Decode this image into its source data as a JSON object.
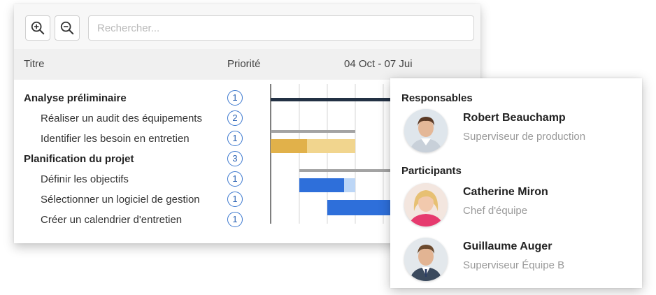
{
  "toolbar": {
    "zoom_in_icon": "zoom-in-icon",
    "zoom_out_icon": "zoom-out-icon",
    "search_placeholder": "Rechercher..."
  },
  "columns": {
    "title": "Titre",
    "priority": "Priorité",
    "timeline": "04 Oct - 07 Jui"
  },
  "tasks": [
    {
      "title": "Analyse préliminaire",
      "priority": "1",
      "group": true
    },
    {
      "title": "Réaliser un audit des équipements",
      "priority": "2",
      "group": false
    },
    {
      "title": "Identifier les besoin en entretien",
      "priority": "1",
      "group": false
    },
    {
      "title": "Planification du projet",
      "priority": "3",
      "group": true
    },
    {
      "title": "Définir les objectifs",
      "priority": "1",
      "group": false
    },
    {
      "title": "Sélectionner un logiciel de gestion",
      "priority": "1",
      "group": false
    },
    {
      "title": "Créer un calendrier d'entretien",
      "priority": "1",
      "group": false
    }
  ],
  "colors": {
    "summary_dark": "#233144",
    "summary_grey": "#a3a3a3",
    "bar_gold": "#e1b14a",
    "bar_gold_light": "#f1d58e",
    "bar_blue": "#2e6fda",
    "bar_blue_light": "#bcd6f6",
    "priority_blue": "#3d79cf"
  },
  "popover": {
    "responsables_heading": "Responsables",
    "participants_heading": "Participants",
    "responsables": [
      {
        "name": "Robert Beauchamp",
        "role": "Superviseur de production"
      }
    ],
    "participants": [
      {
        "name": "Catherine Miron",
        "role": "Chef d'équipe"
      },
      {
        "name": "Guillaume Auger",
        "role": "Superviseur Équipe B"
      }
    ]
  }
}
